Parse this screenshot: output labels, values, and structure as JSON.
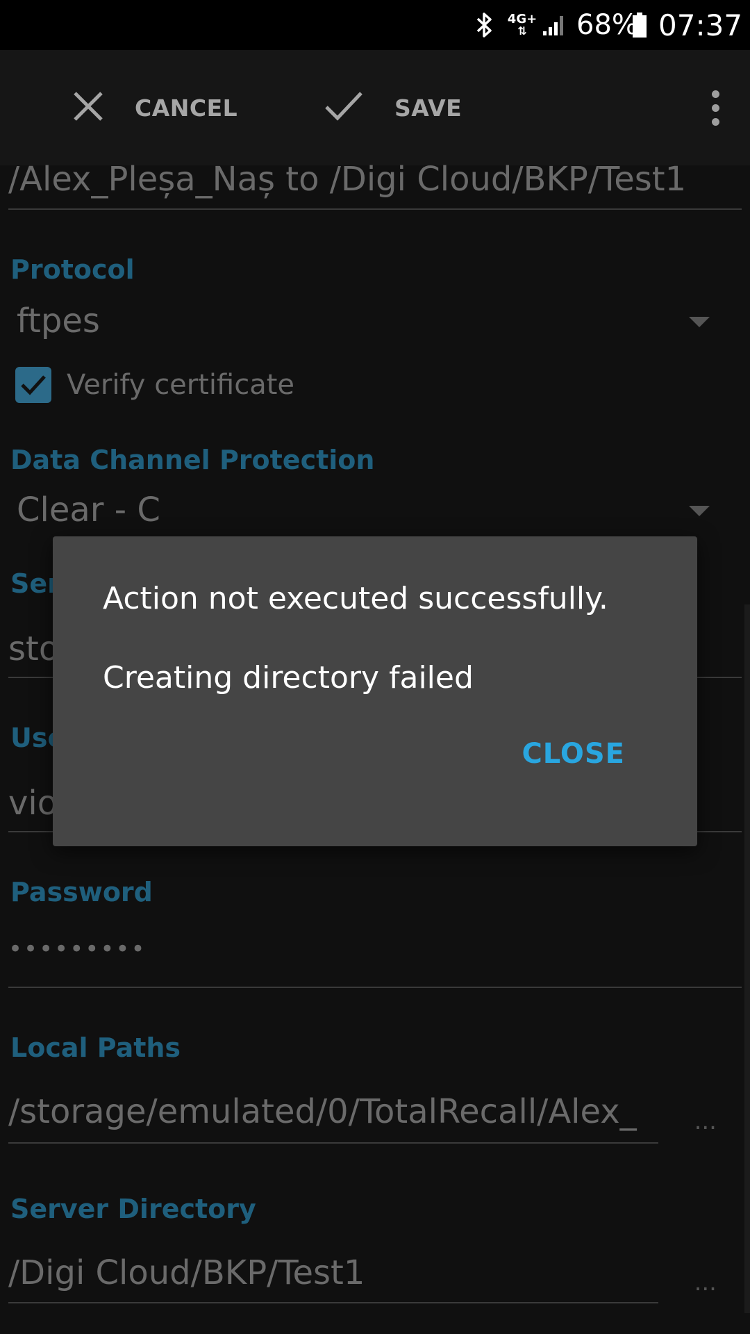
{
  "status_bar": {
    "bluetooth_icon": "bluetooth-icon",
    "network": "4G+",
    "battery": "68%",
    "time": "07:37"
  },
  "toolbar": {
    "cancel_label": "CANCEL",
    "save_label": "SAVE",
    "menu_icon": "overflow-menu-icon"
  },
  "form": {
    "name_value": "/Alex_Pleșa_Naș to /Digi Cloud/BKP/Test1",
    "protocol_label": "Protocol",
    "protocol_value": "ftpes",
    "verify_certificate_label": "Verify certificate",
    "verify_certificate_checked": true,
    "data_channel_label": "Data Channel Protection",
    "data_channel_value": "Clear - C",
    "server_label_partial": "Ser",
    "server_value_partial": "sto",
    "user_label_partial": "Use",
    "user_value_partial": "vio",
    "password_label": "Password",
    "password_value": "•••••••••",
    "local_paths_label": "Local Paths",
    "local_paths_value": "/storage/emulated/0/TotalRecall/Alex_",
    "local_paths_more": "...",
    "server_directory_label": "Server Directory",
    "server_directory_value": "/Digi Cloud/BKP/Test1",
    "server_directory_more": "..."
  },
  "dialog": {
    "title": "Action not executed successfully.",
    "message": "Creating directory failed",
    "close_label": "CLOSE"
  },
  "colors": {
    "accent": "#29a6e0",
    "section_label": "#1f5f7d",
    "dialog_bg": "#454545",
    "background": "#101010"
  }
}
